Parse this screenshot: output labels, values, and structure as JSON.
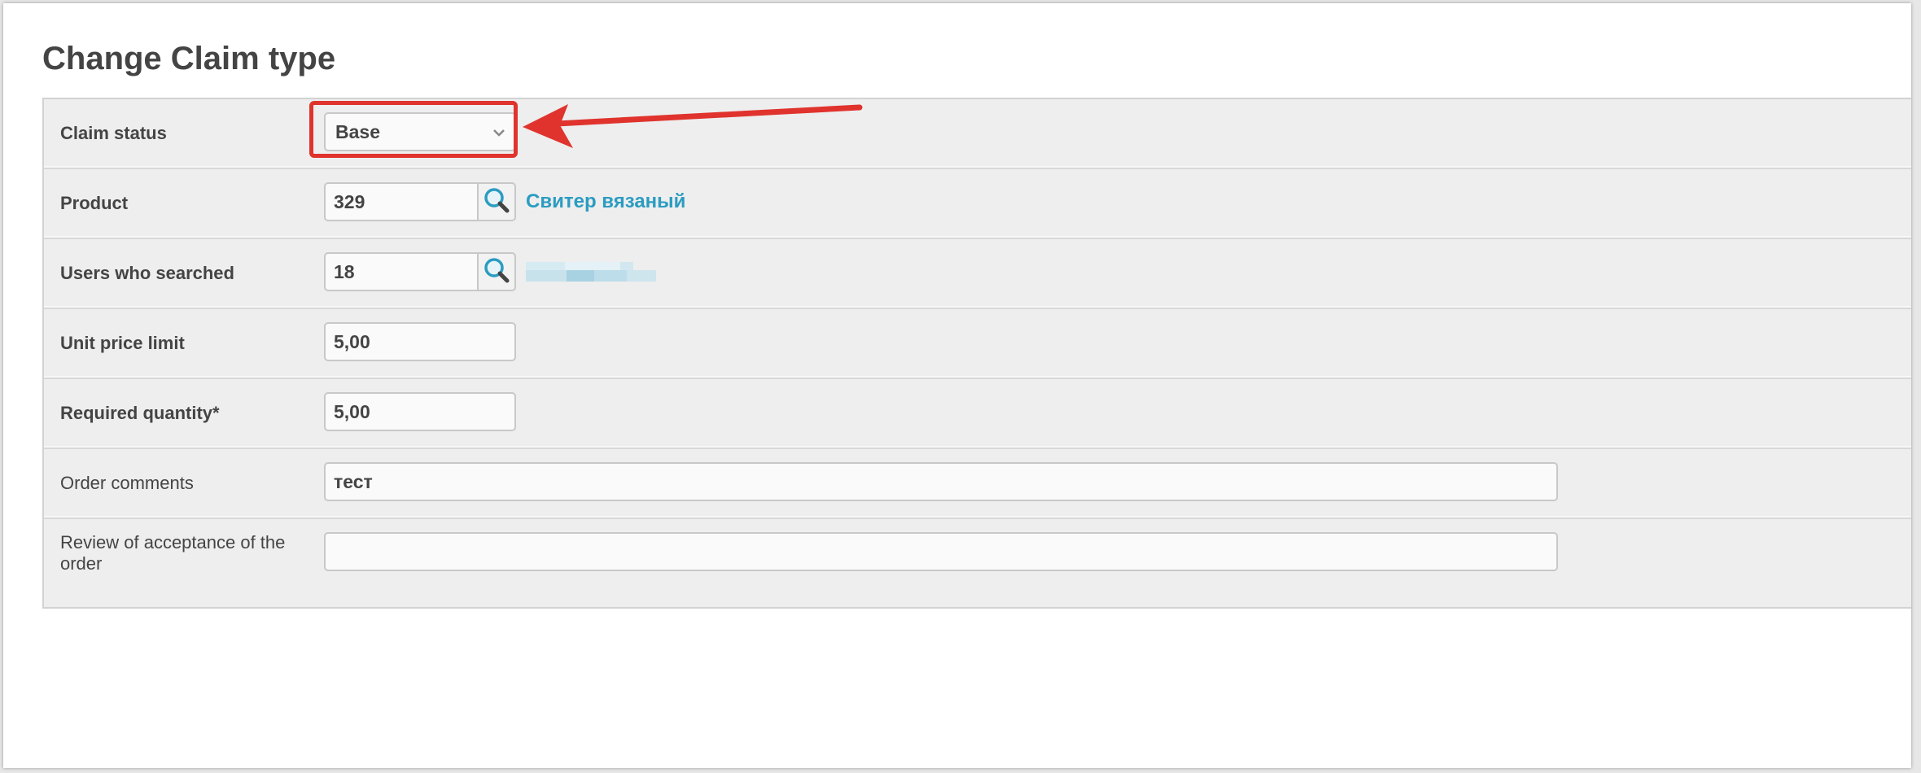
{
  "page": {
    "title": "Change Claim type"
  },
  "form": {
    "claim_status": {
      "label": "Claim status",
      "value": "Base"
    },
    "product": {
      "label": "Product",
      "value": "329",
      "link_text": "Свитер вязаный"
    },
    "users_searched": {
      "label": "Users who searched",
      "value": "18"
    },
    "unit_price_limit": {
      "label": "Unit price limit",
      "value": "5,00"
    },
    "required_quantity": {
      "label": "Required quantity*",
      "value": "5,00"
    },
    "order_comments": {
      "label": "Order comments",
      "value": "тест"
    },
    "review_acceptance": {
      "label": "Review of acceptance of the order",
      "value": ""
    }
  },
  "icons": {
    "dropdown": "chevron-down-icon",
    "lookup": "search-icon"
  },
  "colors": {
    "annotation": "#e0332d",
    "link": "#2b9cc1",
    "panel_bg": "#eeeeee"
  }
}
